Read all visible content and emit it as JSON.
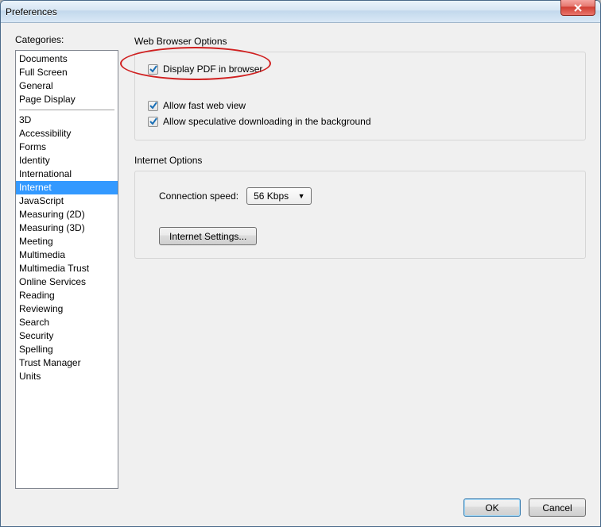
{
  "window": {
    "title": "Preferences"
  },
  "sidebar": {
    "label": "Categories:",
    "group1": [
      "Documents",
      "Full Screen",
      "General",
      "Page Display"
    ],
    "group2": [
      "3D",
      "Accessibility",
      "Forms",
      "Identity",
      "International",
      "Internet",
      "JavaScript",
      "Measuring (2D)",
      "Measuring (3D)",
      "Meeting",
      "Multimedia",
      "Multimedia Trust",
      "Online Services",
      "Reading",
      "Reviewing",
      "Search",
      "Security",
      "Spelling",
      "Trust Manager",
      "Units"
    ],
    "selected": "Internet"
  },
  "main": {
    "web_browser": {
      "title": "Web Browser Options",
      "display_pdf": {
        "label": "Display PDF in browser",
        "checked": true
      },
      "fast_web": {
        "label": "Allow fast web view",
        "checked": true
      },
      "speculative": {
        "label": "Allow speculative downloading in the background",
        "checked": true
      }
    },
    "internet_options": {
      "title": "Internet Options",
      "connection_label": "Connection speed:",
      "connection_value": "56 Kbps",
      "settings_button": "Internet Settings..."
    }
  },
  "footer": {
    "ok": "OK",
    "cancel": "Cancel"
  }
}
